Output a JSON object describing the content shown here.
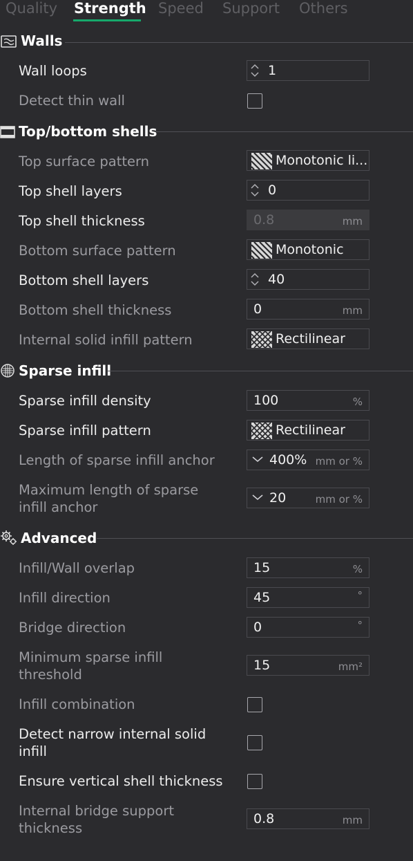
{
  "tabs": [
    "Quality",
    "Strength",
    "Speed",
    "Support",
    "Others"
  ],
  "active_tab": "Strength",
  "accent_color": "#16a96b",
  "sections": {
    "walls": {
      "title": "Walls",
      "icon": "walls-icon",
      "wall_loops": {
        "label": "Wall loops",
        "value": "1"
      },
      "detect_thin_wall": {
        "label": "Detect thin wall",
        "checked": false
      }
    },
    "shells": {
      "title": "Top/bottom shells",
      "icon": "shells-icon",
      "top_surface_pattern": {
        "label": "Top surface pattern",
        "value": "Monotonic li..."
      },
      "top_shell_layers": {
        "label": "Top shell layers",
        "value": "0"
      },
      "top_shell_thickness": {
        "label": "Top shell thickness",
        "value": "0.8",
        "unit": "mm"
      },
      "bottom_surface_pattern": {
        "label": "Bottom surface pattern",
        "value": "Monotonic"
      },
      "bottom_shell_layers": {
        "label": "Bottom shell layers",
        "value": "40"
      },
      "bottom_shell_thickness": {
        "label": "Bottom shell thickness",
        "value": "0",
        "unit": "mm"
      },
      "internal_solid_infill_pattern": {
        "label": "Internal solid infill pattern",
        "value": "Rectilinear"
      }
    },
    "sparse": {
      "title": "Sparse infill",
      "icon": "sparse-infill-icon",
      "density": {
        "label": "Sparse infill density",
        "value": "100",
        "unit": "%"
      },
      "pattern": {
        "label": "Sparse infill pattern",
        "value": "Rectilinear"
      },
      "anchor_length": {
        "label": "Length of sparse infill anchor",
        "value": "400%",
        "unit": "mm or %"
      },
      "anchor_max_length": {
        "label_line1": "Maximum length of sparse",
        "label_line2": "infill anchor",
        "value": "20",
        "unit": "mm or %"
      }
    },
    "advanced": {
      "title": "Advanced",
      "icon": "gear-icon",
      "wall_overlap": {
        "label": "Infill/Wall overlap",
        "value": "15",
        "unit": "%"
      },
      "infill_direction": {
        "label": "Infill direction",
        "value": "45",
        "unit": "°"
      },
      "bridge_direction": {
        "label": "Bridge direction",
        "value": "0",
        "unit": "°"
      },
      "min_sparse_threshold": {
        "label_line1": "Minimum sparse infill",
        "label_line2": "threshold",
        "value": "15",
        "unit": "mm²"
      },
      "infill_combination": {
        "label": "Infill combination",
        "checked": false
      },
      "detect_narrow_solid": {
        "label_line1": "Detect narrow internal solid",
        "label_line2": "infill",
        "checked": false
      },
      "ensure_vertical_shell": {
        "label": "Ensure vertical shell thickness",
        "checked": false
      },
      "internal_bridge_support": {
        "label_line1": "Internal bridge support",
        "label_line2": "thickness",
        "value": "0.8",
        "unit": "mm"
      }
    }
  }
}
